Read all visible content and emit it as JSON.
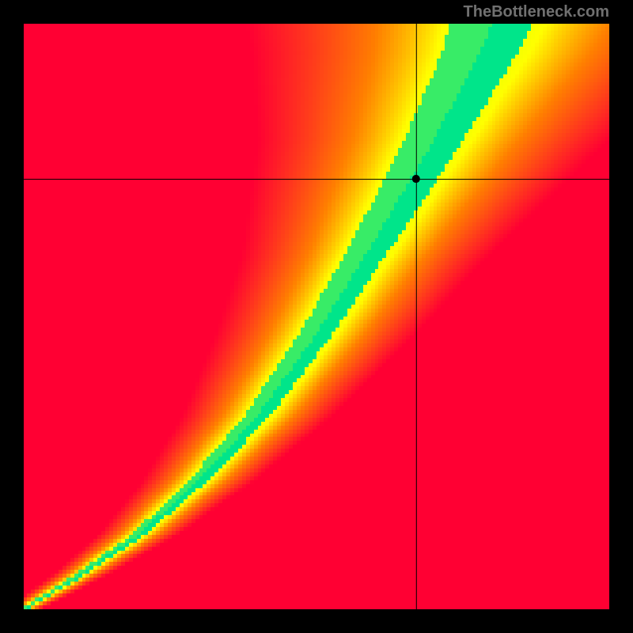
{
  "watermark": "TheBottleneck.com",
  "chart_data": {
    "type": "heatmap",
    "title": "",
    "xlabel": "",
    "ylabel": "",
    "xlim": [
      0,
      1
    ],
    "ylim": [
      0,
      1
    ],
    "grid_size": 150,
    "crosshair": {
      "x": 0.67,
      "y": 0.735
    },
    "colormap": [
      {
        "stop": 0.0,
        "color": "#ff0033"
      },
      {
        "stop": 0.35,
        "color": "#ff7f00"
      },
      {
        "stop": 0.6,
        "color": "#ffff00"
      },
      {
        "stop": 0.8,
        "color": "#e0ff00"
      },
      {
        "stop": 1.0,
        "color": "#00e58a"
      }
    ],
    "ridge": {
      "description": "Pixelated optimal-balance ridge from bottom-left to upper area",
      "points": [
        {
          "x": 0.0,
          "y": 0.0
        },
        {
          "x": 0.1,
          "y": 0.06
        },
        {
          "x": 0.2,
          "y": 0.13
        },
        {
          "x": 0.3,
          "y": 0.22
        },
        {
          "x": 0.4,
          "y": 0.33
        },
        {
          "x": 0.5,
          "y": 0.47
        },
        {
          "x": 0.6,
          "y": 0.63
        },
        {
          "x": 0.7,
          "y": 0.8
        },
        {
          "x": 0.78,
          "y": 0.95
        },
        {
          "x": 0.8,
          "y": 1.0
        }
      ],
      "width_scale": {
        "description": "Green band half-width (in x-units) as function of y",
        "points": [
          {
            "y": 0.0,
            "w": 0.005
          },
          {
            "y": 0.2,
            "w": 0.015
          },
          {
            "y": 0.4,
            "w": 0.025
          },
          {
            "y": 0.6,
            "w": 0.035
          },
          {
            "y": 0.8,
            "w": 0.05
          },
          {
            "y": 1.0,
            "w": 0.07
          }
        ]
      }
    },
    "outer_band_mult": 2.0,
    "distance_gamma": 0.6
  }
}
